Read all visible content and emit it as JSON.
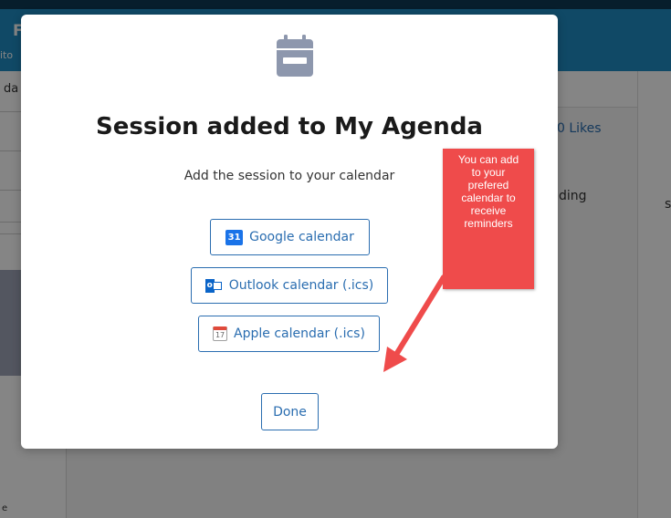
{
  "background": {
    "header_title": "F",
    "header_subtitle": "ito",
    "sidebar_label": "da",
    "sidebar_footer": "e",
    "likes_text": "0 Likes",
    "truncated_text": "ding",
    "edge_text": "s"
  },
  "modal": {
    "title": "Session added to My Agenda",
    "subtitle": "Add the session to your calendar",
    "buttons": {
      "google": {
        "icon_text": "31",
        "label": "Google calendar"
      },
      "outlook": {
        "icon_text": "o",
        "label": "Outlook calendar (.ics)"
      },
      "apple": {
        "icon_text": "17",
        "label": "Apple calendar (.ics)"
      }
    },
    "done_label": "Done"
  },
  "annotation": {
    "lines": [
      "You can add",
      "to your",
      "prefered",
      "calendar to",
      "receive",
      "reminders"
    ]
  },
  "colors": {
    "header": "#1f8dc4",
    "accent_blue": "#2a6db0",
    "calendar_icon": "#8d97ad",
    "callout_red": "#ef4b4b"
  }
}
